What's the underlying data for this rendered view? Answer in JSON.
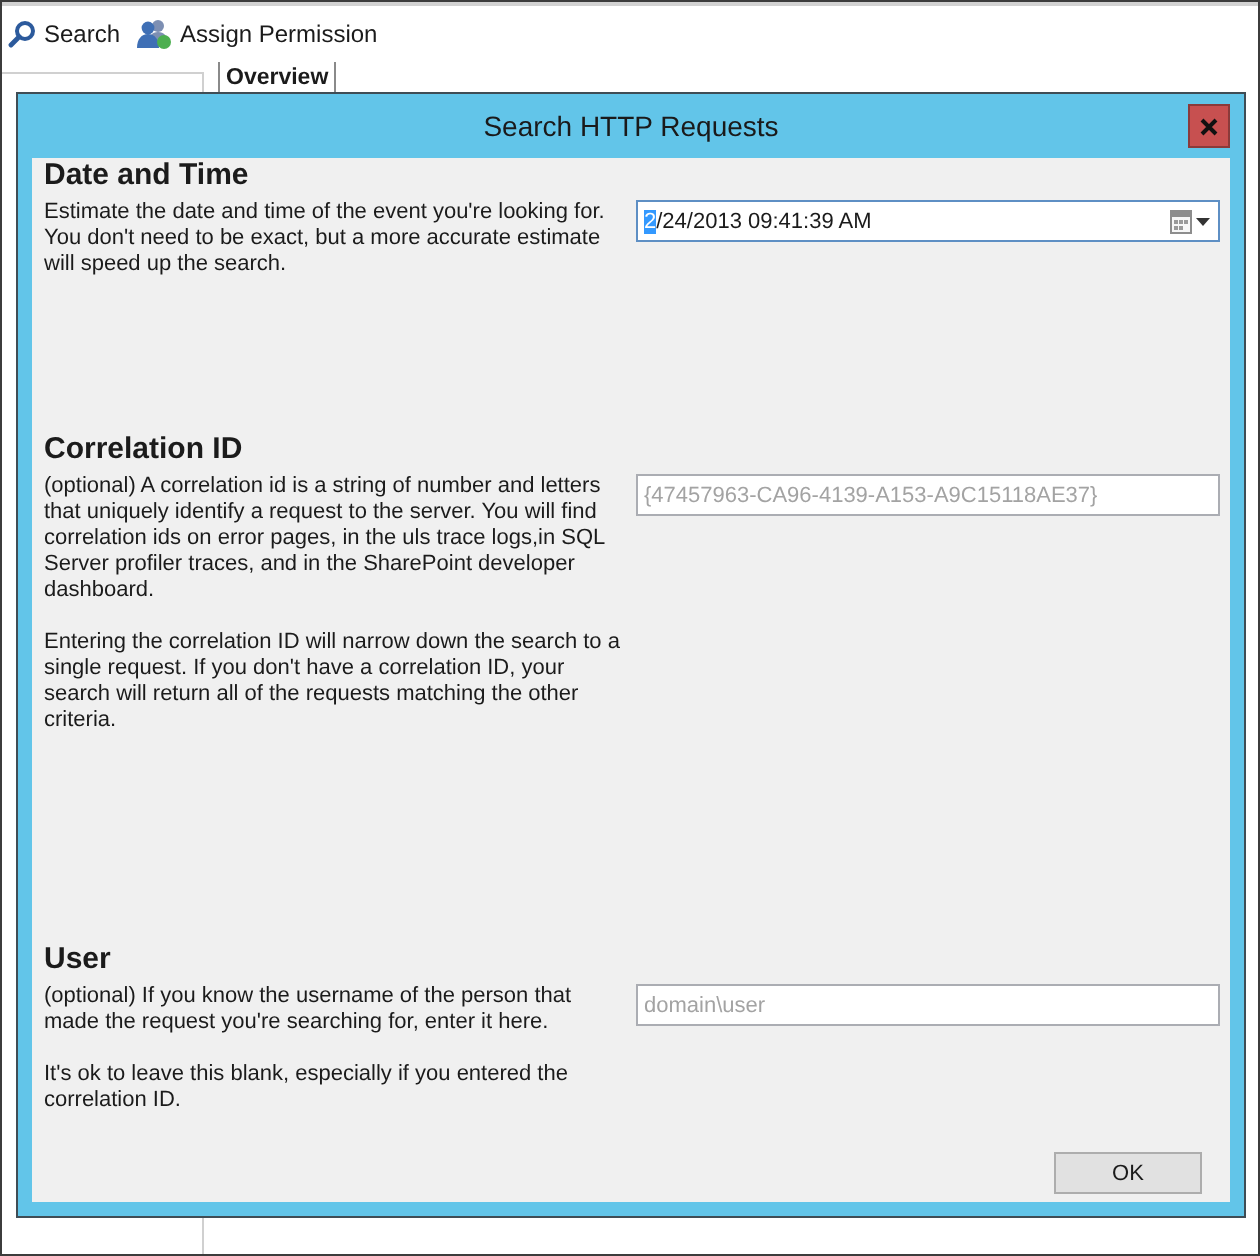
{
  "toolbar": {
    "items": [
      {
        "kind": "search",
        "label": "Search"
      },
      {
        "kind": "permission",
        "label": "Assign Permission"
      }
    ]
  },
  "tabs": [
    {
      "label": "Overview",
      "selected": true
    }
  ],
  "dialog": {
    "title": "Search HTTP Requests",
    "sections": [
      {
        "heading": "Date and Time",
        "paragraphs": [
          "Estimate the date and time of the event you're looking for. You don't need to be exact, but a more accurate estimate will speed up the search."
        ],
        "field": {
          "kind": "datetime",
          "focused": true,
          "segments": [
            {
              "text": "2",
              "selected": true
            },
            {
              "text": "/24/2013 09:41:39 AM",
              "selected": false
            }
          ]
        }
      },
      {
        "heading": "Correlation ID",
        "paragraphs": [
          "(optional) A correlation id is a string of number and letters that uniquely identify a request to the server. You will find correlation ids on error pages, in the uls trace logs,in SQL Server profiler traces, and in the SharePoint developer dashboard.",
          "Entering the correlation ID will narrow down the search to a single request. If you don't have a correlation ID, your search will return all of the requests matching the other criteria."
        ],
        "field": {
          "kind": "text",
          "placeholder": "{47457963-CA96-4139-A153-A9C15118AE37}"
        }
      },
      {
        "heading": "User",
        "paragraphs": [
          "(optional) If you know the username of the person that made the request you're searching for, enter it here.",
          "It's ok to leave this blank, especially if you entered the correlation ID."
        ],
        "field": {
          "kind": "text",
          "placeholder": "domain\\user"
        }
      }
    ],
    "buttons": [
      {
        "label": "OK"
      }
    ]
  }
}
